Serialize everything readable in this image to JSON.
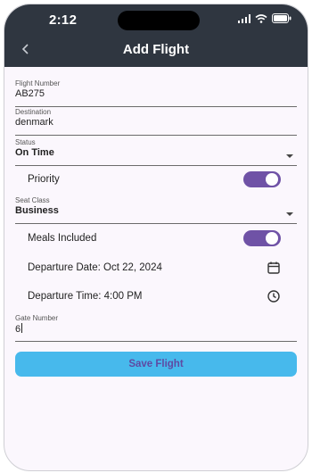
{
  "status_bar": {
    "time": "2:12"
  },
  "header": {
    "title": "Add Flight"
  },
  "form": {
    "flight_number": {
      "label": "Flight Number",
      "value": "AB275"
    },
    "destination": {
      "label": "Destination",
      "value": "denmark"
    },
    "status": {
      "label": "Status",
      "value": "On Time"
    },
    "priority": {
      "label": "Priority",
      "on": true
    },
    "seat_class": {
      "label": "Seat Class",
      "value": "Business"
    },
    "meals": {
      "label": "Meals Included",
      "on": true
    },
    "departure_date": {
      "text": "Departure Date: Oct 22, 2024"
    },
    "departure_time": {
      "text": "Departure Time: 4:00 PM"
    },
    "gate_number": {
      "label": "Gate Number",
      "value": "6"
    },
    "save_label": "Save Flight"
  },
  "colors": {
    "appbar": "#2f3640",
    "toggle": "#6f52a6",
    "button": "#47b9ec",
    "button_text": "#5f4aa3"
  },
  "icons": [
    "back-arrow-icon",
    "wifi-icon",
    "battery-icon",
    "dropdown-icon",
    "calendar-icon",
    "clock-icon"
  ]
}
